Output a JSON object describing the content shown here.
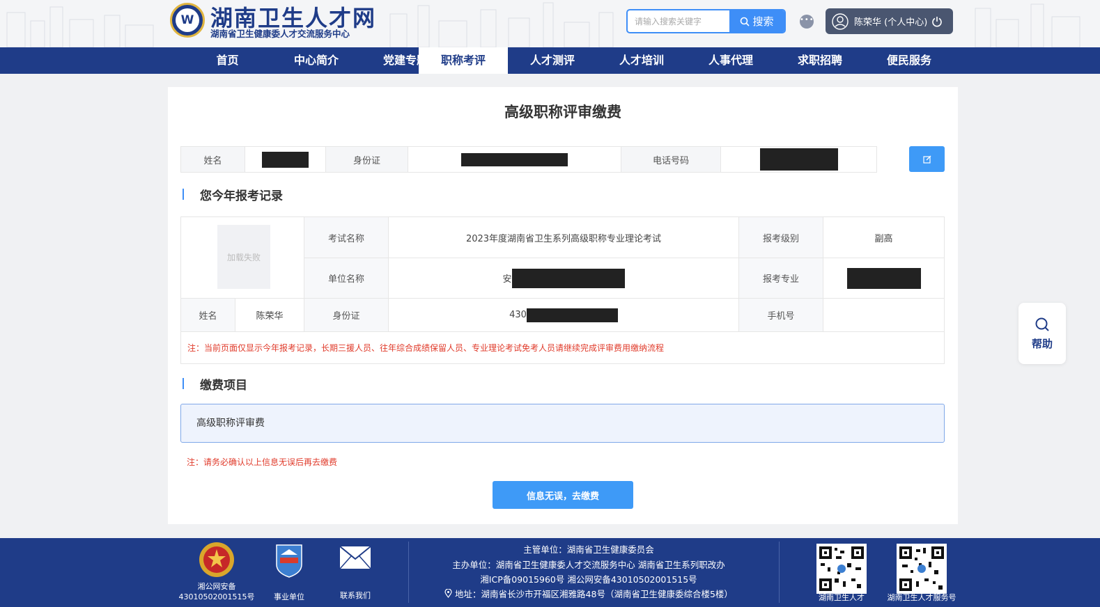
{
  "header": {
    "title": "湖南卫生人才网",
    "subtitle": "湖南省卫生健康委人才交流服务中心",
    "search_placeholder": "请输入搜索关键字",
    "search_button": "搜索",
    "user_label": "陈荣华 (个人中心)"
  },
  "nav": {
    "active": "职称考评",
    "items": [
      "首页",
      "中心简介",
      "党建专题",
      "职称考评",
      "人才测评",
      "人才培训",
      "人事代理",
      "求职招聘",
      "便民服务"
    ]
  },
  "main": {
    "page_title": "高级职称评审缴费",
    "info": {
      "name_label": "姓名",
      "id_label": "身份证",
      "phone_label": "电话号码"
    },
    "record_section_title": "您今年报考记录",
    "record": {
      "photo_text": "加载失败",
      "exam_name_label": "考试名称",
      "exam_name": "2023年度湖南省卫生系列高级职称专业理论考试",
      "level_label": "报考级别",
      "level": "副高",
      "unit_label": "单位名称",
      "unit_prefix": "安",
      "major_label": "报考专业",
      "name_label": "姓名",
      "name": "陈荣华",
      "id_label": "身份证",
      "id_prefix": "430",
      "phone_label": "手机号",
      "phone": ""
    },
    "record_note": "注：当前页面仅显示今年报考记录，长期三援人员、往年综合成绩保留人员、专业理论考试免考人员请继续完成评审费用缴纳流程",
    "fee_section_title": "缴费项目",
    "fee_item": "高级职称评审费",
    "fee_note": "注：请务必确认以上信息无误后再去缴费",
    "pay_button": "信息无误，去缴费"
  },
  "help": {
    "label": "帮助"
  },
  "footer": {
    "police_label_1": "湘公网安备",
    "police_label_2": "43010502001515号",
    "unit_label": "事业单位",
    "contact_label": "联系我们",
    "lines": [
      "主管单位：湖南省卫生健康委员会",
      "主办单位：湖南省卫生健康委人才交流服务中心 湖南省卫生系列职改办",
      "湘ICP备09015960号 湘公网安备43010502001515号",
      "地址：湖南省长沙市开福区湘雅路48号（湖南省卫生健康委综合楼5楼）"
    ],
    "qr1_label": "湖南卫生人才",
    "qr2_label": "湖南卫生人才服务号"
  },
  "colors": {
    "primary": "#1f3c88",
    "accent": "#3e9af7",
    "warning": "#e03b2b"
  }
}
